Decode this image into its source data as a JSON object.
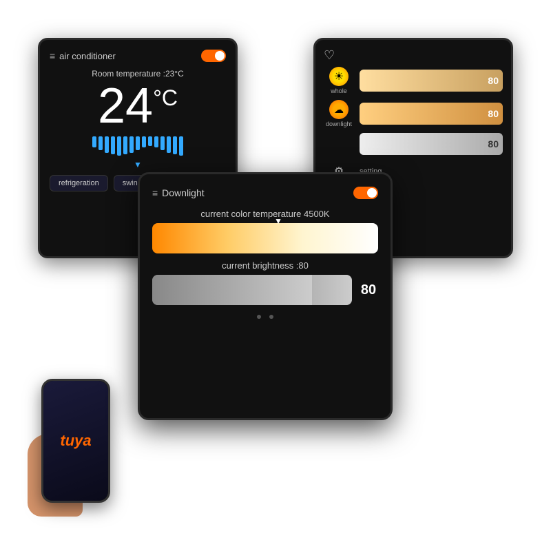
{
  "ac_panel": {
    "title": "air conditioner",
    "room_temp": "Room temperature :23°C",
    "big_temp": "24",
    "deg_symbol": "°C",
    "btn_refrigeration": "refrigeration",
    "btn_swing": "swing"
  },
  "smart_panel": {
    "whole_label": "whole",
    "whole_value": "80",
    "downlight_label": "downlight",
    "downlight_value": "80",
    "extra_value": "80",
    "setting_label": "setting"
  },
  "downlight_panel": {
    "title": "Downlight",
    "ct_label": "current color temperature 4500K",
    "brightness_label": "current brightness :80",
    "brightness_value": "80"
  },
  "phone": {
    "brand": "tuya"
  }
}
